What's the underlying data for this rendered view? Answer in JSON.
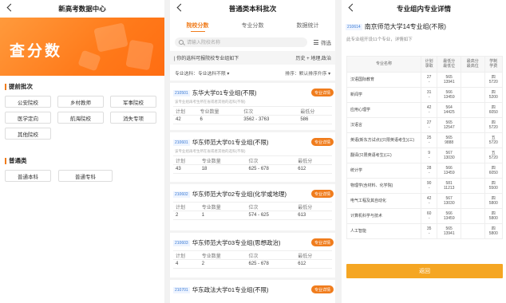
{
  "screen1": {
    "title": "新高考数据中心",
    "banner_text": "查分数",
    "section1_title": "提前批次",
    "section1_buttons": [
      "公安院校",
      "乡村教师",
      "军事院校",
      "医学定向",
      "航海院校",
      "消失专项",
      "其他院校"
    ],
    "section2_title": "普通类",
    "section2_buttons": [
      "普通本科",
      "普通专科"
    ]
  },
  "screen2": {
    "title": "普通类本科批次",
    "tabs": [
      "院校分数",
      "专业分数",
      "数据统计"
    ],
    "search_placeholder": "请输入院校名称",
    "filter_label": "筛选",
    "info_left": "| 你的选科可报院校专业组如下",
    "info_right": "历史 + 地理,政治",
    "sort_left": "专业选科：专业选科不限 ▾",
    "sort_right": "排序：默认排序升序 ▾",
    "detail_label": "专业详情",
    "col_headers": [
      "计划",
      "专业数量",
      "位次",
      "最低分"
    ],
    "col_headers_alt": [
      "计划",
      "专业数",
      "位次",
      "最低分"
    ],
    "cards": [
      {
        "code": "210501",
        "name": "东华大学01专业组(不限)",
        "sub": "该专业组再考生所在省或者其他的选科(不限)",
        "plan": "42",
        "count": "6",
        "rank": "3562 - 3763",
        "score": "586"
      },
      {
        "code": "210601",
        "name": "华东师范大学01专业组(不限)",
        "sub": "该专业组再考生所在省或者其他的选科(不限)",
        "plan": "43",
        "count": "18",
        "rank": "625 - 678",
        "score": "612"
      },
      {
        "code": "210602",
        "name": "华东师范大学02专业组(化学或地理)",
        "sub": "",
        "plan": "2",
        "count": "1",
        "rank": "574 - 625",
        "score": "613"
      },
      {
        "code": "210603",
        "name": "华东师范大学03专业组(思想政治)",
        "sub": "",
        "plan": "4",
        "count": "2",
        "rank": "625 - 678",
        "score": "612"
      },
      {
        "code": "210701",
        "name": "华东政法大学01专业组(不限)",
        "sub": "",
        "plan": "",
        "count": "",
        "rank": "",
        "score": ""
      }
    ]
  },
  "screen3": {
    "title": "专业组内专业详情",
    "group_code": "210614",
    "group_name": "南京师范大学14专业组(不限)",
    "group_desc": "此专业组开设11个专业，详情如下",
    "headers": [
      "专业名称",
      "计划\n录取",
      "最低分\n最低位",
      "最高分\n最高位",
      "学制\n学费"
    ],
    "rows": [
      {
        "name": "汉语国际教育",
        "plan": "27\n-",
        "low": "565\n13941",
        "high": "\n",
        "fee": "四\n5720"
      },
      {
        "name": "新闻学",
        "plan": "31\n-",
        "low": "566\n13459",
        "high": "\n",
        "fee": "四\n5200"
      },
      {
        "name": "应用心理学",
        "plan": "42\n-",
        "low": "564\n14425",
        "high": "\n",
        "fee": "四\n6050"
      },
      {
        "name": "汉语言",
        "plan": "27\n-",
        "low": "565\n12547",
        "high": "\n",
        "fee": "四\n5720"
      },
      {
        "name": "英语(新东方试点)(只限英语考生)(三)",
        "plan": "25\n-",
        "low": "565\n9888",
        "high": "\n",
        "fee": "五\n5720"
      },
      {
        "name": "翻译(只限英语考生)(三)",
        "plan": "9\n-",
        "low": "567\n13030",
        "high": "\n",
        "fee": "五\n5720"
      },
      {
        "name": "统计学",
        "plan": "28\n-",
        "low": "566\n13459",
        "high": "\n",
        "fee": "四\n6050"
      },
      {
        "name": "物理学(含材料、化学院)",
        "plan": "90\n-",
        "low": "581\n11213",
        "high": "\n",
        "fee": "四\n5500"
      },
      {
        "name": "电气工程及其自动化",
        "plan": "42\n-",
        "low": "567\n13030",
        "high": "\n",
        "fee": "四\n5800"
      },
      {
        "name": "计算机科学与技术",
        "plan": "60\n-",
        "low": "566\n13459",
        "high": "\n",
        "fee": "四\n5800"
      },
      {
        "name": "人工智能",
        "plan": "35\n-",
        "low": "565\n13941",
        "high": "\n",
        "fee": "四\n5800"
      }
    ],
    "return_label": "返回"
  }
}
